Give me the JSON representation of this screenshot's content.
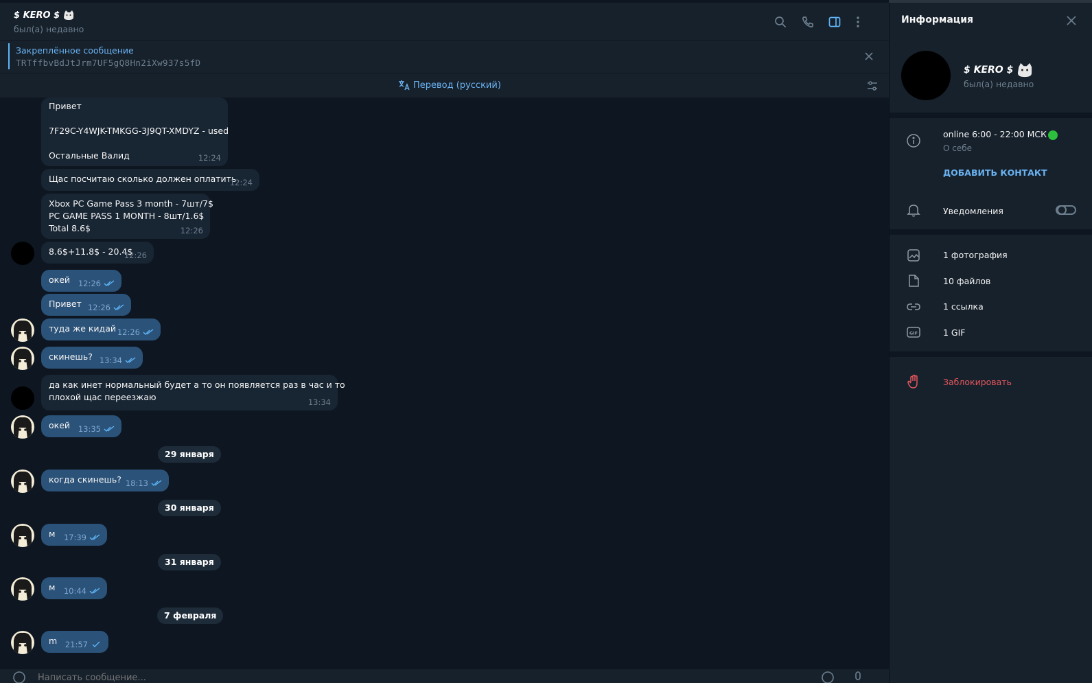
{
  "header": {
    "title": "$ KERO $",
    "status": "был(а) недавно"
  },
  "pinned": {
    "title": "Закреплённое сообщение",
    "text": "TRTffbvBdJtJrm7UF5gQ8Hn2iXw937s5fD"
  },
  "translate": {
    "label": "Перевод (русский)"
  },
  "messages": {
    "m1": {
      "line1": "Привет",
      "line2": "7F29C-Y4WJK-TMKGG-3J9QT-XMDYZ - used",
      "line3": "Остальные Валид",
      "time": "12:24"
    },
    "m2": {
      "text": "Щас посчитаю сколько должен оплатить",
      "time": "12:24"
    },
    "m3": {
      "line1": "Xbox PC Game Pass 3 month - 7шт/7$",
      "line2": "PC GAME PASS 1 MONTH - 8шт/1.6$",
      "line3": "Total 8.6$",
      "time": "12:26"
    },
    "m4": {
      "text": "8.6$+11.8$ - 20.4$",
      "time": "12:26"
    },
    "m5": {
      "text": "окей",
      "time": "12:26"
    },
    "m6": {
      "text": "Привет",
      "time": "12:26"
    },
    "m7": {
      "text": "туда же кидай",
      "time": "12:26"
    },
    "m8": {
      "text": "скинешь?",
      "time": "13:34"
    },
    "m9": {
      "line1": "да как инет нормальный будет а то он появляется раз в час и то",
      "line2": "плохой щас переезжаю",
      "time": "13:34"
    },
    "m10": {
      "text": "окей",
      "time": "13:35"
    },
    "m11": {
      "text": "когда скинешь?",
      "time": "18:13"
    },
    "m12": {
      "text": "м",
      "time": "17:39"
    },
    "m13": {
      "text": "м",
      "time": "10:44"
    },
    "m14": {
      "text": "m",
      "time": "21:57"
    }
  },
  "dates": {
    "d1": "29 января",
    "d2": "30 января",
    "d3": "31 января",
    "d4": "7 февраля"
  },
  "composer": {
    "placeholder": "Написать сообщение..."
  },
  "info": {
    "title": "Информация",
    "name": "$ KERO $",
    "status": "был(а) недавно",
    "bio": "online 6:00 - 22:00 МСК",
    "bio_label": "О себе",
    "add_contact": "ДОБАВИТЬ КОНТАКТ",
    "notifications": "Уведомления",
    "notifications_on": false,
    "photos": "1 фотография",
    "files": "10 файлов",
    "links": "1 ссылка",
    "gifs": "1 GIF",
    "block": "Заблокировать"
  },
  "colors": {
    "background": "#0e1621",
    "panel": "#17212b",
    "bubble_in": "#182533",
    "bubble_out": "#2b5278",
    "accent": "#6ab3f3",
    "danger": "#e5565e",
    "online": "#2dbf3e"
  },
  "icons": [
    "search-icon",
    "phone-icon",
    "sidebar-icon",
    "more-icon",
    "close-icon",
    "translate-icon",
    "settings-icon",
    "info-icon",
    "bell-icon",
    "photo-icon",
    "file-icon",
    "link-icon",
    "gif-icon",
    "block-hand-icon",
    "cat-emoji-icon",
    "double-check-icon",
    "attach-icon",
    "emoji-icon",
    "mic-icon"
  ]
}
